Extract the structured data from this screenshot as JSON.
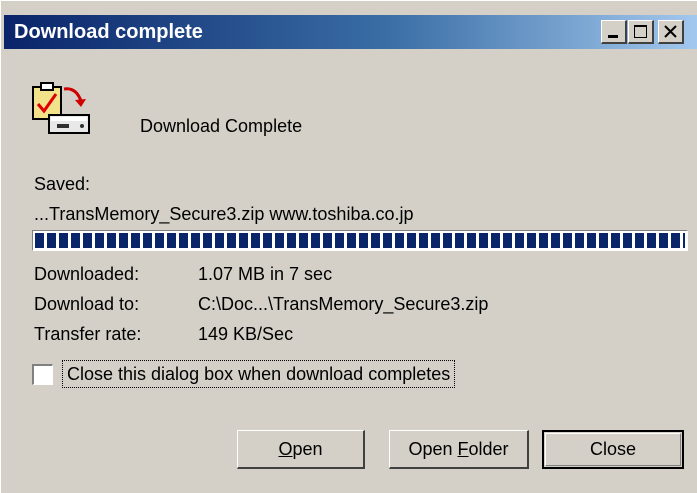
{
  "window": {
    "title": "Download complete",
    "controls": {
      "minimize_icon": "minimize-icon",
      "maximize_icon": "maximize-icon",
      "close_icon": "close-icon"
    }
  },
  "header": {
    "icon": "download-complete-icon",
    "label": "Download Complete"
  },
  "saved": {
    "label": "Saved:",
    "value": "...TransMemory_Secure3.zip www.toshiba.co.jp"
  },
  "progress": {
    "percent": 100
  },
  "details": {
    "downloaded_label": "Downloaded:",
    "downloaded_value": "1.07 MB in 7 sec",
    "download_to_label": "Download to:",
    "download_to_value": "C:\\Doc...\\TransMemory_Secure3.zip",
    "transfer_rate_label": "Transfer rate:",
    "transfer_rate_value": "149 KB/Sec"
  },
  "close_option": {
    "label": "Close this dialog box when download completes",
    "checked": false
  },
  "buttons": {
    "open_accel": "O",
    "open_rest": "pen",
    "open_folder_pre": "Open ",
    "open_folder_accel": "F",
    "open_folder_rest": "older",
    "close": "Close"
  },
  "colors": {
    "titlebar_start": "#0a246a",
    "titlebar_end": "#a6caf0",
    "dialog_face": "#d4d0c8",
    "progress_fill": "#0a246a"
  }
}
